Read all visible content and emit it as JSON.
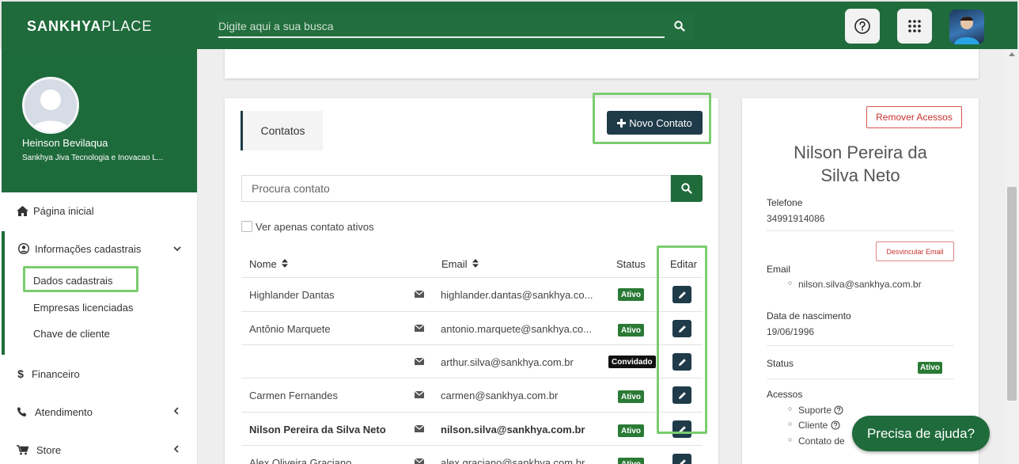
{
  "header": {
    "logo_bold": "SANKHYA",
    "logo_light": "PLACE",
    "search_placeholder": "Digite aqui a sua busca"
  },
  "sidebar": {
    "user_name": "Heinson Bevilaqua",
    "company": "Sankhya Jiva Tecnologia e Inovacao L...",
    "items": [
      {
        "label": "Página inicial",
        "icon": "home-icon"
      },
      {
        "label": "Informações cadastrais",
        "icon": "user-circle-icon"
      },
      {
        "label": "Financeiro",
        "icon": "dollar-icon"
      },
      {
        "label": "Atendimento",
        "icon": "phone-icon"
      },
      {
        "label": "Store",
        "icon": "cart-icon"
      }
    ],
    "submenu": [
      "Dados cadastrais",
      "Empresas licenciadas",
      "Chave de cliente"
    ]
  },
  "contacts": {
    "tab_label": "Contatos",
    "new_button": "Novo Contato",
    "search_placeholder": "Procura contato",
    "filter_label": "Ver apenas contato ativos",
    "columns": {
      "name": "Nome",
      "email": "Email",
      "status": "Status",
      "edit": "Editar"
    },
    "rows": [
      {
        "name": "Highlander Dantas",
        "email": "highlander.dantas@sankhya.co...",
        "status": "Ativo"
      },
      {
        "name": "Antônio Marquete",
        "email": "antonio.marquete@sankhya.co...",
        "status": "Ativo"
      },
      {
        "name": "",
        "email": "arthur.silva@sankhya.com.br",
        "status": "Convidado"
      },
      {
        "name": "Carmen Fernandes",
        "email": "carmen@sankhya.com.br",
        "status": "Ativo"
      },
      {
        "name": "Nilson Pereira da Silva Neto",
        "email": "nilson.silva@sankhya.com.br",
        "status": "Ativo"
      },
      {
        "name": "Alex Oliveira Graciano",
        "email": "alex.graciano@sankhya.com.br",
        "status": "Ativo"
      }
    ]
  },
  "detail": {
    "remove_button": "Remover Acessos",
    "name_line1": "Nilson Pereira da",
    "name_line2": "Silva Neto",
    "phone_label": "Telefone",
    "phone": "34991914086",
    "unlink_button": "Desvincular Email",
    "email_label": "Email",
    "email": "nilson.silva@sankhya.com.br",
    "birth_label": "Data de nascimento",
    "birth": "19/06/1996",
    "status_label": "Status",
    "status": "Ativo",
    "access_label": "Acessos",
    "access": [
      "Suporte",
      "Cliente",
      "Contato de"
    ]
  },
  "help_button": "Precisa de ajuda?",
  "colors": {
    "brand_green": "#1f6b3b",
    "dark_button": "#1f3b4a",
    "highlight": "#7acd6e",
    "danger": "#d9534f"
  }
}
